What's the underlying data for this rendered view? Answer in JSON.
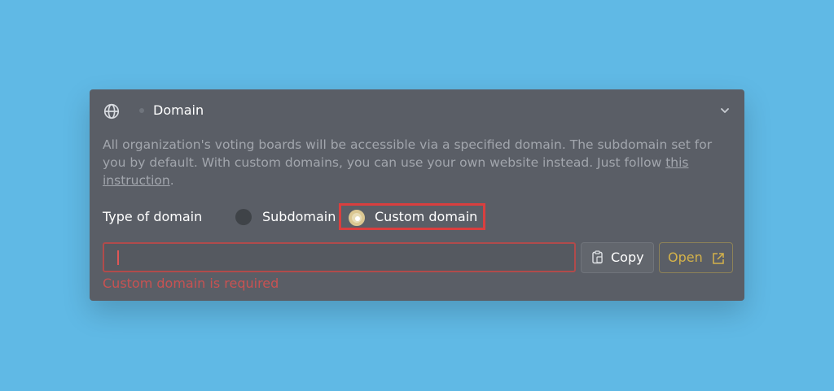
{
  "panel": {
    "title": "Domain",
    "description_main": "All organization's voting boards will be accessible via a specified domain. The subdomain set for you by default. With custom domains, you can use your own website instead. Just follow ",
    "description_link": "this instruction",
    "description_end": ".",
    "type_label": "Type of domain",
    "options": [
      {
        "label": "Subdomain",
        "selected": false
      },
      {
        "label": "Custom domain",
        "selected": true
      }
    ],
    "domain_input": {
      "value": "",
      "placeholder": ""
    },
    "copy_label": "Copy",
    "open_label": "Open",
    "error": "Custom domain is required"
  },
  "icons": {
    "globe": "globe-icon",
    "chevron": "chevron-down-icon",
    "copy": "clipboard-icon",
    "open": "external-link-icon"
  },
  "colors": {
    "background": "#60b9e5",
    "panel": "#5a5e66",
    "accent": "#d4b24a",
    "error": "#c85252",
    "highlight": "#d93f3f"
  }
}
